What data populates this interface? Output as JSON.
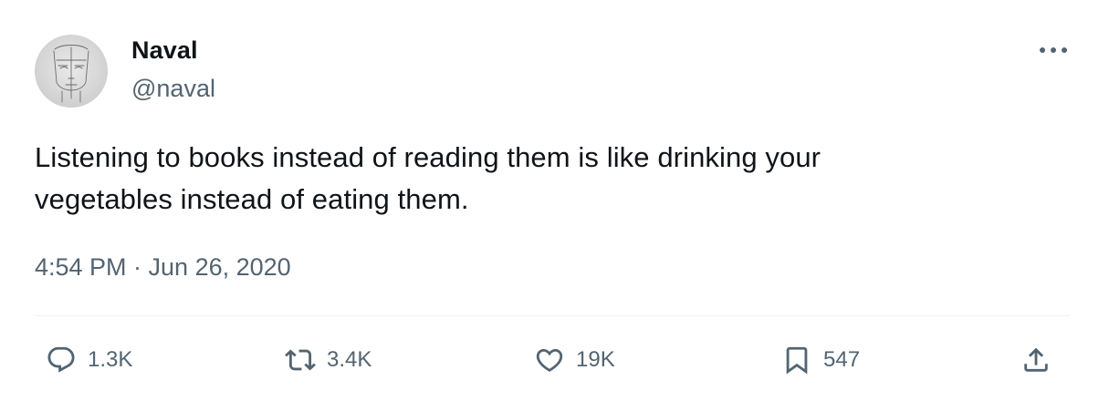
{
  "author": {
    "display_name": "Naval",
    "handle": "@naval"
  },
  "tweet": {
    "text_line1": "Listening to books instead of reading them is like drinking your",
    "text_line2": "vegetables instead of eating them.",
    "timestamp": "4:54 PM · Jun 26, 2020"
  },
  "actions": {
    "replies": "1.3K",
    "retweets": "3.4K",
    "likes": "19K",
    "bookmarks": "547"
  },
  "icons": {
    "avatar": "sketch-face-avatar",
    "more": "more-horizontal-icon",
    "reply": "reply-icon",
    "retweet": "retweet-icon",
    "like": "heart-icon",
    "bookmark": "bookmark-icon",
    "share": "share-icon"
  },
  "colors": {
    "text_primary": "#0f1419",
    "text_secondary": "#536471",
    "divider": "#eff3f4",
    "background": "#ffffff"
  }
}
